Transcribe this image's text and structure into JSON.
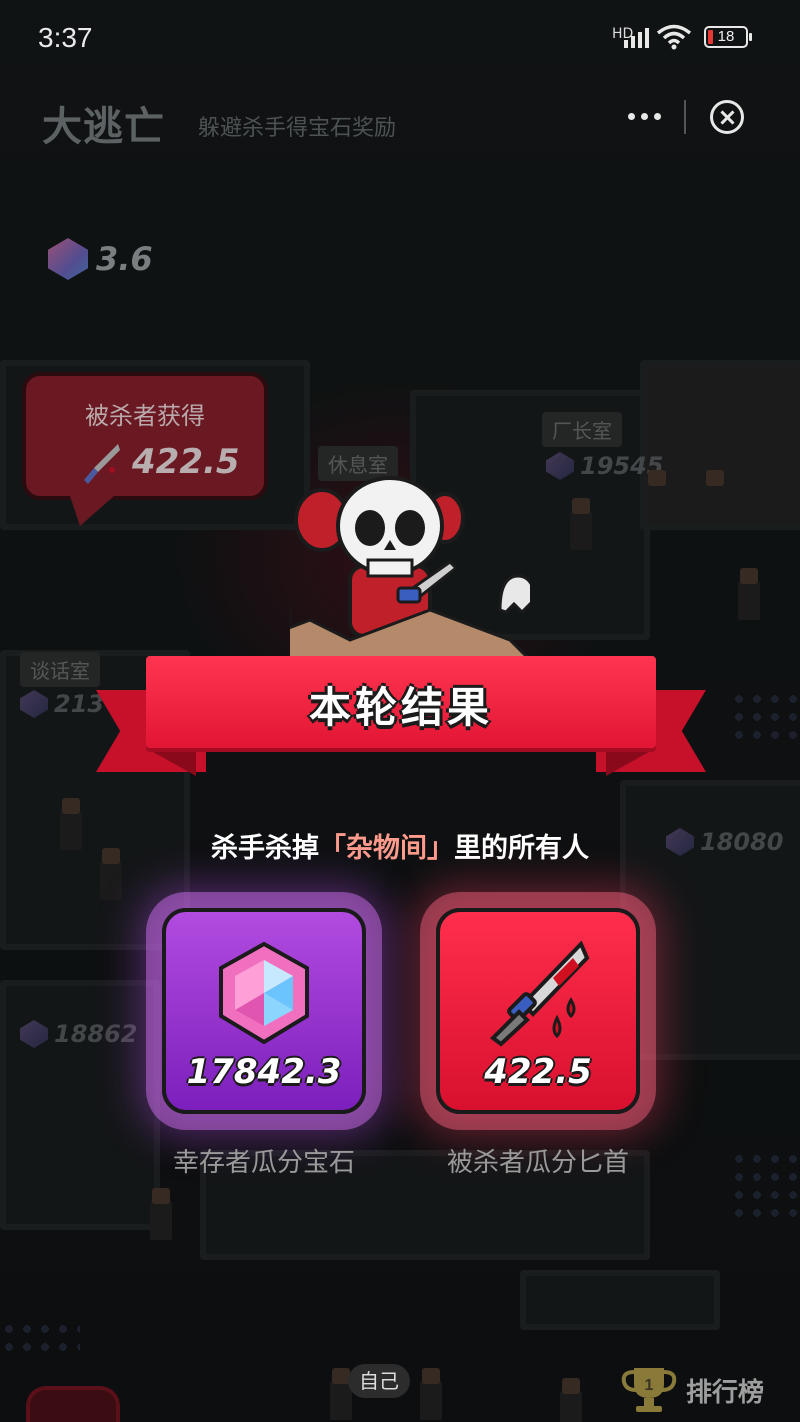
{
  "status_bar": {
    "time": "3:37",
    "network": "HD",
    "battery": "18"
  },
  "header": {
    "title": "大逃亡",
    "subtitle": "躲避杀手得宝石奖励"
  },
  "gem_counter": "3.6",
  "rooms": {
    "factory_director": {
      "label": "厂长室",
      "gems": "19545"
    },
    "lounge": {
      "label": "休息室"
    },
    "talk_room": {
      "label": "谈话室",
      "gems": "213"
    },
    "right_room": {
      "gems": "18080"
    },
    "left_room": {
      "gems": "18862"
    }
  },
  "victim_bubble": {
    "label": "被杀者获得",
    "value": "422.5"
  },
  "result": {
    "banner": "本轮结果",
    "line_prefix": "杀手杀掉",
    "line_room": "「杂物间」",
    "line_suffix": "里的所有人",
    "gem_card": {
      "value": "17842.3",
      "caption": "幸存者瓜分宝石",
      "icon": "gem-icon"
    },
    "knife_card": {
      "value": "422.5",
      "caption": "被杀者瓜分匕首",
      "icon": "knife-icon"
    }
  },
  "bottom": {
    "self_label": "自己",
    "rank_label": "排行榜",
    "trophy_number": "1"
  },
  "colors": {
    "gem_card": "#9b35d6",
    "knife_card": "#f0213f",
    "banner": "#e8213f",
    "highlight": "#ff9b8c"
  }
}
